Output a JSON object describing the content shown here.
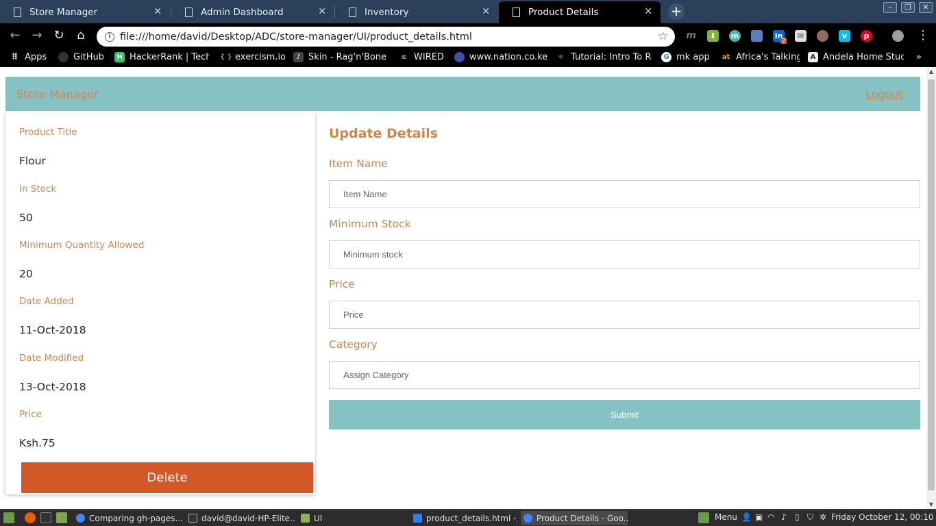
{
  "browser": {
    "tabs": [
      {
        "title": "Store Manager",
        "active": false
      },
      {
        "title": "Admin Dashboard",
        "active": false
      },
      {
        "title": "Inventory",
        "active": false
      },
      {
        "title": "Product Details",
        "active": true
      }
    ],
    "url": "file:///home/david/Desktop/ADC/store-manager/UI/product_details.html",
    "bookmarks": [
      {
        "label": "Apps",
        "icon": "apps-grid-icon"
      },
      {
        "label": "GitHub",
        "icon": "github-icon"
      },
      {
        "label": "HackerRank | Techn",
        "icon": "hackerrank-icon"
      },
      {
        "label": "exercism.io",
        "icon": "exercism-icon"
      },
      {
        "label": "Skin - Rag'n'Bone M",
        "icon": "music-icon"
      },
      {
        "label": "WIRED",
        "icon": "wired-icon"
      },
      {
        "label": "www.nation.co.ke",
        "icon": "globe-icon"
      },
      {
        "label": "Tutorial: Intro To Re",
        "icon": "react-icon"
      },
      {
        "label": "mk app",
        "icon": "google-icon"
      },
      {
        "label": "Africa's Talking",
        "icon": "africastalking-icon"
      },
      {
        "label": "Andela Home Stud",
        "icon": "andela-icon"
      }
    ],
    "extension_badge": "2"
  },
  "page": {
    "brand": "Store Manager",
    "logout": "Logout",
    "product": {
      "title_label": "Product Title",
      "title_value": "Flour",
      "stock_label": "In Stock",
      "stock_value": "50",
      "min_qty_label": "Minimum Quantity Allowed",
      "min_qty_value": "20",
      "date_added_label": "Date Added",
      "date_added_value": "11-Oct-2018",
      "date_modified_label": "Date Modified",
      "date_modified_value": "13-Oct-2018",
      "price_label": "Price",
      "price_value": "Ksh.75",
      "delete_label": "Delete"
    },
    "form": {
      "title": "Update Details",
      "item_name_label": "Item Name",
      "item_name_placeholder": "Item Name",
      "min_stock_label": "Minimum Stock",
      "min_stock_placeholder": "Minimum stock",
      "price_label": "Price",
      "price_placeholder": "Price",
      "category_label": "Category",
      "category_placeholder": "Assign Category",
      "submit_label": "Submit"
    }
  },
  "taskbar": {
    "windows": [
      {
        "title": "Comparing gh-pages....",
        "active": false
      },
      {
        "title": "david@david-HP-Elite...",
        "active": false
      },
      {
        "title": "UI",
        "active": false
      },
      {
        "title": "product_details.html -...",
        "active": false
      },
      {
        "title": "Product Details - Goo...",
        "active": true
      }
    ],
    "menu_label": "Menu",
    "clock": "Friday October 12, 00:10"
  },
  "colors": {
    "accent": "#c9884f",
    "nav_bg": "#86c2c4",
    "delete_bg": "#d25828",
    "tab_strip": "#2a3f5a"
  }
}
